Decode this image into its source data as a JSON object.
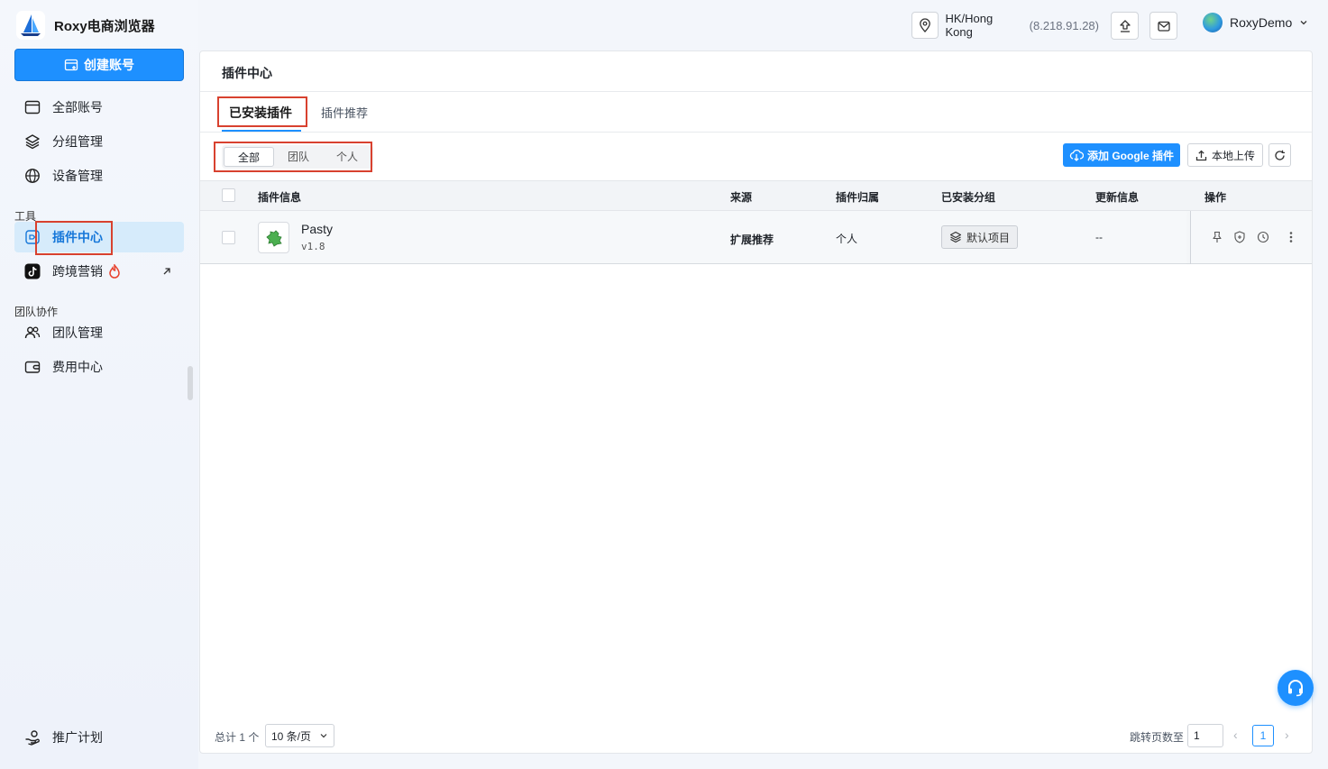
{
  "app": {
    "title": "Roxy电商浏览器"
  },
  "sidebar": {
    "create_button": "创建账号",
    "items_main": [
      {
        "label": "全部账号"
      },
      {
        "label": "分组管理"
      },
      {
        "label": "设备管理"
      }
    ],
    "section_tools": "工具",
    "items_tools": [
      {
        "label": "插件中心",
        "active": true
      },
      {
        "label": "跨境营销"
      }
    ],
    "section_team": "团队协作",
    "items_team": [
      {
        "label": "团队管理"
      },
      {
        "label": "费用中心"
      }
    ],
    "bottom_item": "推广计划"
  },
  "topbar": {
    "location": "HK/Hong Kong",
    "ip": "(8.218.91.28)",
    "username": "RoxyDemo"
  },
  "main": {
    "title": "插件中心",
    "tabs": [
      {
        "label": "已安装插件",
        "active": true
      },
      {
        "label": "插件推荐"
      }
    ],
    "filters": [
      {
        "label": "全部",
        "active": true
      },
      {
        "label": "团队"
      },
      {
        "label": "个人"
      }
    ],
    "buttons": {
      "add_google": "添加 Google 插件",
      "local_upload": "本地上传"
    },
    "table": {
      "headers": [
        "插件信息",
        "来源",
        "插件归属",
        "已安装分组",
        "更新信息",
        "操作"
      ],
      "rows": [
        {
          "name": "Pasty",
          "version": "v1.8",
          "source": "扩展推荐",
          "owner": "个人",
          "group": "默认项目",
          "update": "--"
        }
      ]
    },
    "footer": {
      "total": "总计 1 个",
      "page_size": "10 条/页",
      "jump_label": "跳转页数至",
      "jump_value": "1",
      "current_page": "1"
    }
  },
  "colors": {
    "accent": "#1e90ff",
    "highlight_box": "#d8412f"
  }
}
